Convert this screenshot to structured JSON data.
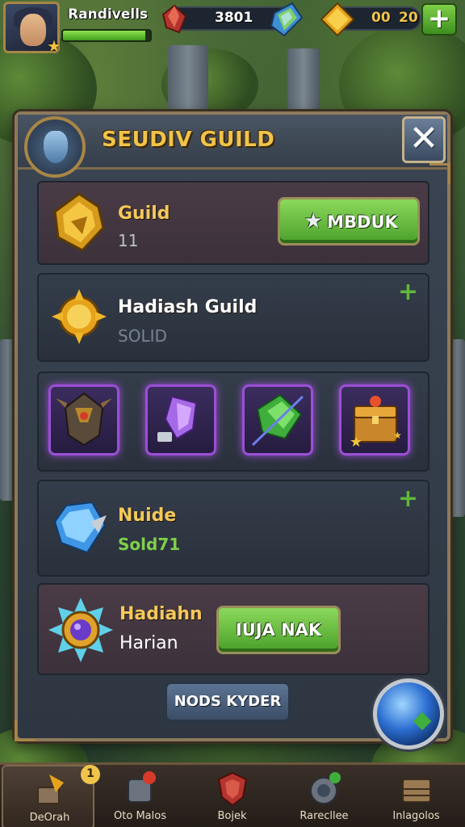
{
  "hud": {
    "player_name": "Randivells",
    "xp_fraction": 0.94,
    "resource_a": "3801",
    "resource_b_1": "00",
    "resource_b_2": "20",
    "add_icon": "plus-icon"
  },
  "panel": {
    "title": "SEUDIV GUILD",
    "close_icon": "close-icon"
  },
  "rows": {
    "guild": {
      "title": "Guild",
      "sub": "11",
      "button": "MBDUK"
    },
    "hadiash": {
      "title": "Hadiash Guild",
      "sub": "SOLID"
    },
    "slots": [
      "helmet-icon",
      "crystal-vial-icon",
      "green-gem-icon",
      "treasure-chest-icon"
    ],
    "nuide": {
      "title": "Nuide",
      "sub": "Sold71"
    },
    "hadiahn": {
      "title": "Hadiahn",
      "sub": "Harian",
      "button": "IUJA NAK"
    }
  },
  "bottom_button": "NODS KYDER",
  "nav": {
    "items": [
      {
        "label": "DeOrah",
        "badge": "1"
      },
      {
        "label": "Oto Malos"
      },
      {
        "label": "Bojek"
      },
      {
        "label": "Rarecllee"
      },
      {
        "label": "Inlagolos"
      }
    ]
  },
  "colors": {
    "accent_gold": "#f0c44a",
    "button_green": "#6fc445",
    "panel": "#343d4a"
  }
}
